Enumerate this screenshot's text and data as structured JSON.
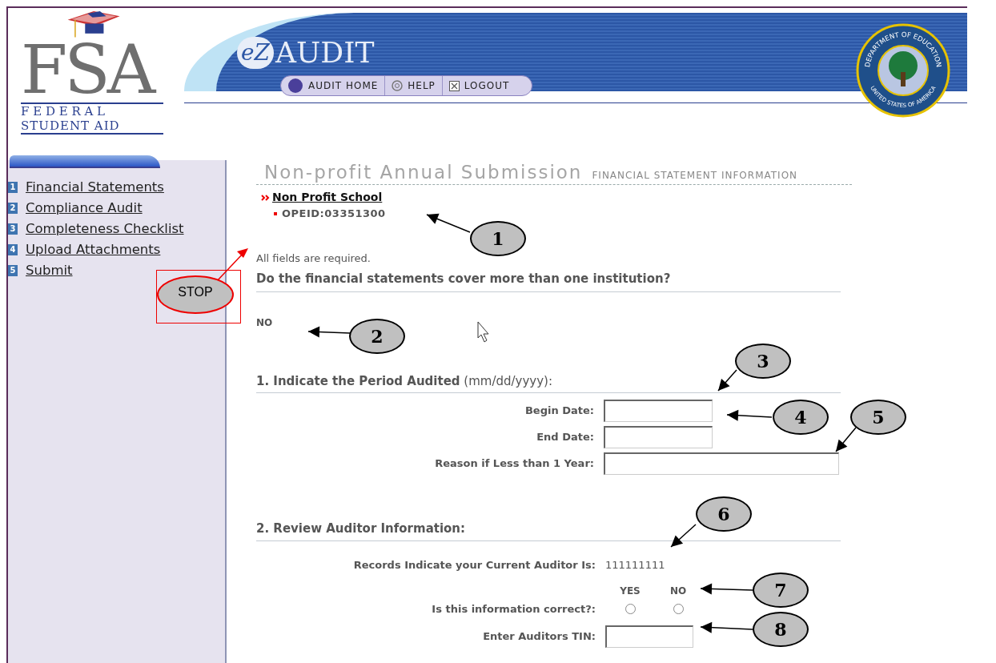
{
  "logo": {
    "letters": "FSA",
    "line_1": "F E D E R A L",
    "line_2": "STUDENT AID"
  },
  "app_logo": {
    "mark": "eZ",
    "name": "AUDIT"
  },
  "nav": [
    {
      "label": "AUDIT HOME",
      "kind": "home"
    },
    {
      "label": "HELP",
      "kind": "help"
    },
    {
      "label": "LOGOUT",
      "kind": "logout"
    }
  ],
  "seal": {
    "top_text": "DEPARTMENT OF EDUCATION",
    "bottom_text": "UNITED STATES OF AMERICA"
  },
  "sidebar": {
    "items": [
      {
        "number": "1",
        "label": "Financial Statements"
      },
      {
        "number": "2",
        "label": "Compliance Audit"
      },
      {
        "number": "3",
        "label": "Completeness Checklist"
      },
      {
        "number": "4",
        "label": "Upload Attachments"
      },
      {
        "number": "5",
        "label": "Submit"
      }
    ]
  },
  "page": {
    "title": "Non-profit Annual Submission",
    "subtitle": "FINANCIAL STATEMENT INFORMATION",
    "school": "Non Profit School",
    "opeid": "OPEID:03351300",
    "required_note": "All fields are required.",
    "question": "Do the financial statements cover more than one institution?",
    "answer": "NO"
  },
  "section_1": {
    "heading": "**1. Indicate the Period Audited** (mm/dd/yyyy):",
    "fields": [
      {
        "label": "Begin Date:",
        "kind": "short"
      },
      {
        "label": "End Date:",
        "kind": "short"
      },
      {
        "label": "Reason if Less than 1 Year:",
        "kind": "long"
      }
    ]
  },
  "section_2": {
    "heading": "2. Review Auditor Information:",
    "auditor_label": "Records Indicate your Current Auditor Is:",
    "auditor_value": "111111111",
    "question": "Is this information correct?:",
    "options": [
      {
        "label": "YES",
        "selected": false
      },
      {
        "label": "NO",
        "selected": false
      }
    ],
    "tin_label": "Enter Auditors TIN:"
  },
  "callouts": [
    {
      "label": "1"
    },
    {
      "label": "2"
    },
    {
      "label": "3"
    },
    {
      "label": "4"
    },
    {
      "label": "5"
    },
    {
      "label": "6"
    },
    {
      "label": "7"
    },
    {
      "label": "8"
    }
  ],
  "stop_callout": {
    "label": "STOP"
  }
}
